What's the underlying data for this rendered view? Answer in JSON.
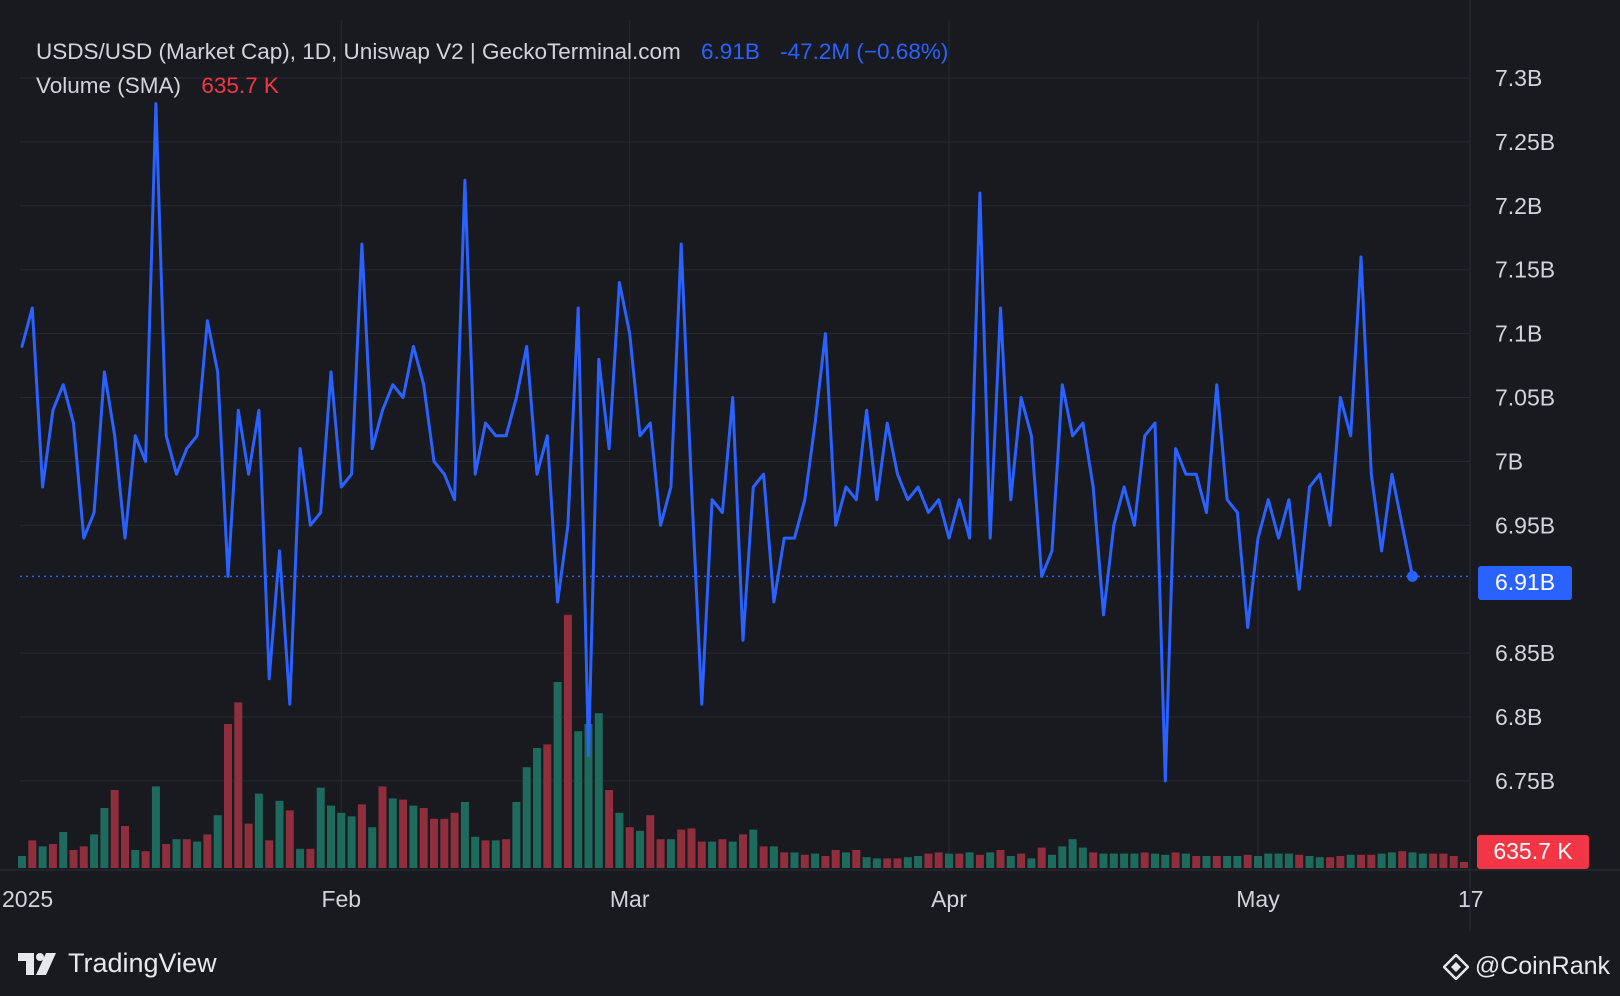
{
  "legend": {
    "title": "USDS/USD (Market Cap), 1D, Uniswap V2 | GeckoTerminal.com",
    "last_value": "6.91B",
    "change": "-47.2M (−0.68%)",
    "volume_label": "Volume (SMA)",
    "volume_value": "635.7 K"
  },
  "price_badge": "6.91B",
  "volume_badge": "635.7 K",
  "footer": {
    "brand": "TradingView",
    "watermark": "@CoinRank"
  },
  "colors": {
    "background": "#181a1f",
    "line": "#2962ff",
    "volume_up": "#1e6b5e",
    "volume_down": "#8f2f3d",
    "text": "#d1d4dc",
    "volume_badge": "#f23645"
  },
  "chart_data": {
    "type": "line",
    "title": "USDS/USD (Market Cap), 1D, Uniswap V2 | GeckoTerminal.com",
    "y_unit": "USD (billions)",
    "ylim": [
      6.7,
      7.34
    ],
    "y_ticks": [
      {
        "v": 7.3,
        "label": "7.3B"
      },
      {
        "v": 7.25,
        "label": "7.25B"
      },
      {
        "v": 7.2,
        "label": "7.2B"
      },
      {
        "v": 7.15,
        "label": "7.15B"
      },
      {
        "v": 7.1,
        "label": "7.1B"
      },
      {
        "v": 7.05,
        "label": "7.05B"
      },
      {
        "v": 7.0,
        "label": "7B"
      },
      {
        "v": 6.95,
        "label": "6.95B"
      },
      {
        "v": 6.85,
        "label": "6.85B"
      },
      {
        "v": 6.8,
        "label": "6.8B"
      },
      {
        "v": 6.75,
        "label": "6.75B"
      }
    ],
    "x_ticks": [
      {
        "day": 0,
        "label": "2025"
      },
      {
        "day": 31,
        "label": "Feb"
      },
      {
        "day": 59,
        "label": "Mar"
      },
      {
        "day": 90,
        "label": "Apr"
      },
      {
        "day": 120,
        "label": "May"
      },
      {
        "day": 136,
        "label": "17"
      }
    ],
    "series": [
      {
        "values": [
          7.09,
          7.12,
          6.98,
          7.04,
          7.06,
          7.03,
          6.94,
          6.96,
          7.07,
          7.02,
          6.94,
          7.02,
          7.0,
          7.28,
          7.02,
          6.99,
          7.01,
          7.02,
          7.11,
          7.07,
          6.91,
          7.04,
          6.99,
          7.04,
          6.83,
          6.93,
          6.81,
          7.01,
          6.95,
          6.96,
          7.07,
          6.98,
          6.99,
          7.17,
          7.01,
          7.04,
          7.06,
          7.05,
          7.09,
          7.06,
          7.0,
          6.99,
          6.97,
          7.22,
          6.99,
          7.03,
          7.02,
          7.02,
          7.05,
          7.09,
          6.99,
          7.02,
          6.89,
          6.95,
          7.12,
          6.77,
          7.08,
          7.01,
          7.14,
          7.1,
          7.02,
          7.03,
          6.95,
          6.98,
          7.17,
          6.98,
          6.81,
          6.97,
          6.96,
          7.05,
          6.86,
          6.98,
          6.99,
          6.89,
          6.94,
          6.94,
          6.97,
          7.03,
          7.1,
          6.95,
          6.98,
          6.97,
          7.04,
          6.97,
          7.03,
          6.99,
          6.97,
          6.98,
          6.96,
          6.97,
          6.94,
          6.97,
          6.94,
          7.21,
          6.94,
          7.12,
          6.97,
          7.05,
          7.02,
          6.91,
          6.93,
          7.06,
          7.02,
          7.03,
          6.98,
          6.88,
          6.95,
          6.98,
          6.95,
          7.02,
          7.03,
          6.75,
          7.01,
          6.99,
          6.99,
          6.96,
          7.06,
          6.97,
          6.96,
          6.87,
          6.94,
          6.97,
          6.94,
          6.97,
          6.9,
          6.98,
          6.99,
          6.95,
          7.05,
          7.02,
          7.16,
          6.99,
          6.93,
          6.99,
          6.95,
          6.91
        ]
      }
    ],
    "volume": [
      {
        "v": 0.1,
        "up": true
      },
      {
        "v": 0.23,
        "up": false
      },
      {
        "v": 0.18,
        "up": true
      },
      {
        "v": 0.2,
        "up": false
      },
      {
        "v": 0.3,
        "up": true
      },
      {
        "v": 0.15,
        "up": false
      },
      {
        "v": 0.18,
        "up": false
      },
      {
        "v": 0.28,
        "up": true
      },
      {
        "v": 0.5,
        "up": true
      },
      {
        "v": 0.65,
        "up": false
      },
      {
        "v": 0.35,
        "up": false
      },
      {
        "v": 0.15,
        "up": true
      },
      {
        "v": 0.14,
        "up": false
      },
      {
        "v": 0.68,
        "up": true
      },
      {
        "v": 0.2,
        "up": false
      },
      {
        "v": 0.24,
        "up": true
      },
      {
        "v": 0.24,
        "up": false
      },
      {
        "v": 0.22,
        "up": true
      },
      {
        "v": 0.28,
        "up": false
      },
      {
        "v": 0.44,
        "up": true
      },
      {
        "v": 1.2,
        "up": false
      },
      {
        "v": 1.38,
        "up": false
      },
      {
        "v": 0.37,
        "up": false
      },
      {
        "v": 0.62,
        "up": true
      },
      {
        "v": 0.23,
        "up": false
      },
      {
        "v": 0.56,
        "up": true
      },
      {
        "v": 0.48,
        "up": false
      },
      {
        "v": 0.16,
        "up": true
      },
      {
        "v": 0.16,
        "up": false
      },
      {
        "v": 0.67,
        "up": true
      },
      {
        "v": 0.52,
        "up": true
      },
      {
        "v": 0.46,
        "up": true
      },
      {
        "v": 0.43,
        "up": true
      },
      {
        "v": 0.53,
        "up": false
      },
      {
        "v": 0.34,
        "up": true
      },
      {
        "v": 0.68,
        "up": false
      },
      {
        "v": 0.58,
        "up": true
      },
      {
        "v": 0.57,
        "up": false
      },
      {
        "v": 0.52,
        "up": true
      },
      {
        "v": 0.5,
        "up": false
      },
      {
        "v": 0.41,
        "up": false
      },
      {
        "v": 0.41,
        "up": false
      },
      {
        "v": 0.46,
        "up": false
      },
      {
        "v": 0.55,
        "up": true
      },
      {
        "v": 0.26,
        "up": true
      },
      {
        "v": 0.23,
        "up": false
      },
      {
        "v": 0.23,
        "up": true
      },
      {
        "v": 0.24,
        "up": false
      },
      {
        "v": 0.55,
        "up": true
      },
      {
        "v": 0.84,
        "up": true
      },
      {
        "v": 1.0,
        "up": true
      },
      {
        "v": 1.03,
        "up": false
      },
      {
        "v": 1.55,
        "up": true
      },
      {
        "v": 2.11,
        "up": false
      },
      {
        "v": 1.14,
        "up": true
      },
      {
        "v": 1.2,
        "up": true
      },
      {
        "v": 1.29,
        "up": true
      },
      {
        "v": 0.65,
        "up": false
      },
      {
        "v": 0.46,
        "up": true
      },
      {
        "v": 0.34,
        "up": false
      },
      {
        "v": 0.31,
        "up": true
      },
      {
        "v": 0.44,
        "up": false
      },
      {
        "v": 0.24,
        "up": false
      },
      {
        "v": 0.24,
        "up": true
      },
      {
        "v": 0.32,
        "up": false
      },
      {
        "v": 0.33,
        "up": false
      },
      {
        "v": 0.22,
        "up": false
      },
      {
        "v": 0.22,
        "up": true
      },
      {
        "v": 0.24,
        "up": false
      },
      {
        "v": 0.22,
        "up": true
      },
      {
        "v": 0.28,
        "up": false
      },
      {
        "v": 0.32,
        "up": true
      },
      {
        "v": 0.18,
        "up": false
      },
      {
        "v": 0.18,
        "up": true
      },
      {
        "v": 0.13,
        "up": false
      },
      {
        "v": 0.13,
        "up": true
      },
      {
        "v": 0.11,
        "up": false
      },
      {
        "v": 0.12,
        "up": true
      },
      {
        "v": 0.1,
        "up": false
      },
      {
        "v": 0.15,
        "up": false
      },
      {
        "v": 0.13,
        "up": true
      },
      {
        "v": 0.15,
        "up": false
      },
      {
        "v": 0.09,
        "up": true
      },
      {
        "v": 0.08,
        "up": true
      },
      {
        "v": 0.08,
        "up": false
      },
      {
        "v": 0.08,
        "up": false
      },
      {
        "v": 0.09,
        "up": true
      },
      {
        "v": 0.1,
        "up": true
      },
      {
        "v": 0.12,
        "up": false
      },
      {
        "v": 0.13,
        "up": false
      },
      {
        "v": 0.12,
        "up": true
      },
      {
        "v": 0.12,
        "up": false
      },
      {
        "v": 0.13,
        "up": true
      },
      {
        "v": 0.11,
        "up": false
      },
      {
        "v": 0.13,
        "up": true
      },
      {
        "v": 0.15,
        "up": false
      },
      {
        "v": 0.1,
        "up": true
      },
      {
        "v": 0.12,
        "up": false
      },
      {
        "v": 0.08,
        "up": true
      },
      {
        "v": 0.17,
        "up": false
      },
      {
        "v": 0.11,
        "up": true
      },
      {
        "v": 0.18,
        "up": true
      },
      {
        "v": 0.24,
        "up": true
      },
      {
        "v": 0.17,
        "up": true
      },
      {
        "v": 0.13,
        "up": false
      },
      {
        "v": 0.12,
        "up": true
      },
      {
        "v": 0.12,
        "up": true
      },
      {
        "v": 0.12,
        "up": true
      },
      {
        "v": 0.12,
        "up": true
      },
      {
        "v": 0.13,
        "up": false
      },
      {
        "v": 0.12,
        "up": true
      },
      {
        "v": 0.11,
        "up": true
      },
      {
        "v": 0.13,
        "up": false
      },
      {
        "v": 0.12,
        "up": true
      },
      {
        "v": 0.1,
        "up": false
      },
      {
        "v": 0.1,
        "up": true
      },
      {
        "v": 0.1,
        "up": false
      },
      {
        "v": 0.1,
        "up": true
      },
      {
        "v": 0.1,
        "up": true
      },
      {
        "v": 0.11,
        "up": false
      },
      {
        "v": 0.1,
        "up": true
      },
      {
        "v": 0.12,
        "up": true
      },
      {
        "v": 0.12,
        "up": true
      },
      {
        "v": 0.12,
        "up": true
      },
      {
        "v": 0.11,
        "up": false
      },
      {
        "v": 0.1,
        "up": true
      },
      {
        "v": 0.09,
        "up": true
      },
      {
        "v": 0.09,
        "up": false
      },
      {
        "v": 0.1,
        "up": false
      },
      {
        "v": 0.11,
        "up": true
      },
      {
        "v": 0.11,
        "up": false
      },
      {
        "v": 0.11,
        "up": false
      },
      {
        "v": 0.12,
        "up": true
      },
      {
        "v": 0.13,
        "up": true
      },
      {
        "v": 0.14,
        "up": false
      },
      {
        "v": 0.13,
        "up": true
      },
      {
        "v": 0.12,
        "up": true
      },
      {
        "v": 0.12,
        "up": false
      },
      {
        "v": 0.12,
        "up": false
      },
      {
        "v": 0.1,
        "up": false
      },
      {
        "v": 0.05,
        "up": false
      }
    ],
    "volume_unit": "millions",
    "grid": true,
    "legend_position": "top-left"
  }
}
